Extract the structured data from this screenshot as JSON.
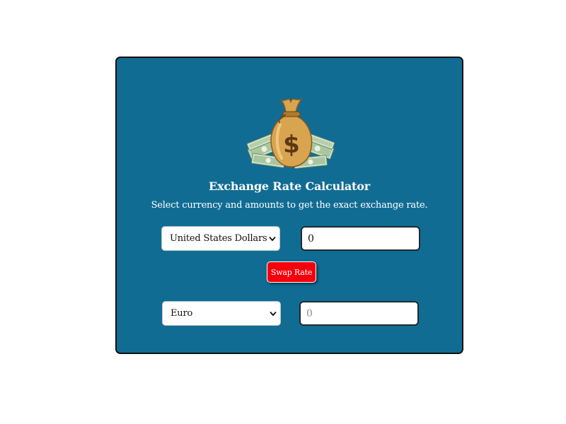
{
  "calculator": {
    "title": "Exchange Rate Calculator",
    "subtitle": "Select currency and amounts to get the exact exchange rate.",
    "logo_icon": "money-bag-icon",
    "from": {
      "currency": "United States Dollars",
      "amount": "0"
    },
    "swap_label": "Swap Rate",
    "to": {
      "currency": "Euro",
      "amount_placeholder": "0"
    }
  },
  "colors": {
    "card_background": "#116c94",
    "swap_button": "#f4000c",
    "text": "#ffffff"
  }
}
